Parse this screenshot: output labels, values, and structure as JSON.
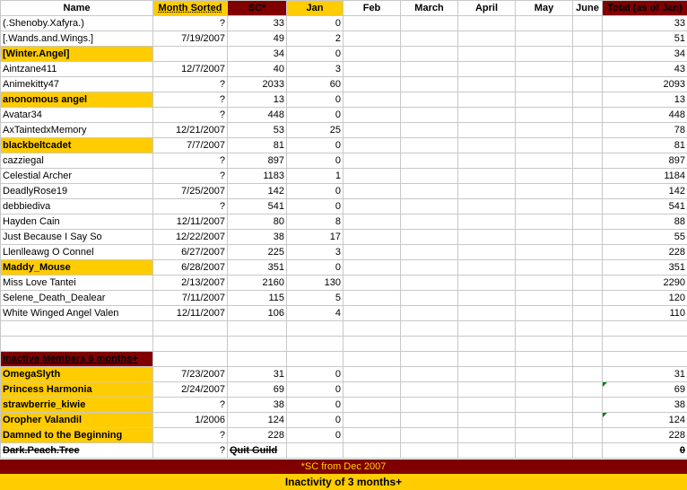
{
  "headers": {
    "name": "Name",
    "month_sorted": "Month Sorted",
    "sc": "SC*",
    "jan": "Jan",
    "feb": "Feb",
    "march": "March",
    "april": "April",
    "may": "May",
    "june": "June",
    "total": "Total (as of Jan)"
  },
  "active_members": [
    {
      "name": "(.Shenoby.Xafyra.)",
      "month": "?",
      "sc": "33",
      "jan": "0",
      "total": "33",
      "highlight": false
    },
    {
      "name": "[.Wands.and.Wings.]",
      "month": "7/19/2007",
      "sc": "49",
      "jan": "2",
      "total": "51",
      "highlight": false
    },
    {
      "name": "[Winter.Angel]",
      "month": "",
      "sc": "34",
      "jan": "0",
      "total": "34",
      "highlight": true
    },
    {
      "name": "Aintzane411",
      "month": "12/7/2007",
      "sc": "40",
      "jan": "3",
      "total": "43",
      "highlight": false
    },
    {
      "name": "Animekitty47",
      "month": "?",
      "sc": "2033",
      "jan": "60",
      "total": "2093",
      "highlight": false
    },
    {
      "name": "anonomous angel",
      "month": "?",
      "sc": "13",
      "jan": "0",
      "total": "13",
      "highlight": true
    },
    {
      "name": "Avatar34",
      "month": "?",
      "sc": "448",
      "jan": "0",
      "total": "448",
      "highlight": false
    },
    {
      "name": "AxTaintedxMemory",
      "month": "12/21/2007",
      "sc": "53",
      "jan": "25",
      "total": "78",
      "highlight": false
    },
    {
      "name": "blackbeltcadet",
      "month": "7/7/2007",
      "sc": "81",
      "jan": "0",
      "total": "81",
      "highlight": true
    },
    {
      "name": "cazziegal",
      "month": "?",
      "sc": "897",
      "jan": "0",
      "total": "897",
      "highlight": false
    },
    {
      "name": "Celestial Archer",
      "month": "?",
      "sc": "1183",
      "jan": "1",
      "total": "1184",
      "highlight": false
    },
    {
      "name": "DeadlyRose19",
      "month": "7/25/2007",
      "sc": "142",
      "jan": "0",
      "total": "142",
      "highlight": false
    },
    {
      "name": "debbiediva",
      "month": "?",
      "sc": "541",
      "jan": "0",
      "total": "541",
      "highlight": false
    },
    {
      "name": "Hayden Cain",
      "month": "12/11/2007",
      "sc": "80",
      "jan": "8",
      "total": "88",
      "highlight": false
    },
    {
      "name": "Just Because I Say So",
      "month": "12/22/2007",
      "sc": "38",
      "jan": "17",
      "total": "55",
      "highlight": false
    },
    {
      "name": "Llenlleawg O Connel",
      "month": "6/27/2007",
      "sc": "225",
      "jan": "3",
      "total": "228",
      "highlight": false
    },
    {
      "name": "Maddy_Mouse",
      "month": "6/28/2007",
      "sc": "351",
      "jan": "0",
      "total": "351",
      "highlight": true
    },
    {
      "name": "Miss Love Tantei",
      "month": "2/13/2007",
      "sc": "2160",
      "jan": "130",
      "total": "2290",
      "highlight": false
    },
    {
      "name": "Selene_Death_Dealear",
      "month": "7/11/2007",
      "sc": "115",
      "jan": "5",
      "total": "120",
      "highlight": false
    },
    {
      "name": "White Winged Angel Valen",
      "month": "12/11/2007",
      "sc": "106",
      "jan": "4",
      "total": "110",
      "highlight": false
    }
  ],
  "inactive_section_title": "Inactive Members 6 months+",
  "inactive_members": [
    {
      "name": "OmegaSlyth",
      "month": "7/23/2007",
      "sc": "31",
      "jan": "0",
      "total": "31",
      "flag": false
    },
    {
      "name": "Princess Harmonia",
      "month": "2/24/2007",
      "sc": "69",
      "jan": "0",
      "total": "69",
      "flag": true
    },
    {
      "name": "strawberrie_kiwie",
      "month": "?",
      "sc": "38",
      "jan": "0",
      "total": "38",
      "flag": false
    },
    {
      "name": "Oropher Valandil",
      "month": "1/2006",
      "sc": "124",
      "jan": "0",
      "total": "124",
      "flag": true
    },
    {
      "name": "Damned to the Beginning",
      "month": "?",
      "sc": "228",
      "jan": "0",
      "total": "228",
      "flag": false
    }
  ],
  "quit_member": {
    "name": "Dark.Peach.Tree",
    "month": "?",
    "sc": "Quit Guild",
    "total": "0"
  },
  "footer_note": "*SC from Dec 2007",
  "footer_legend": "Inactivity of 3 months+",
  "colors": {
    "maroon": "#800000",
    "gold": "#ffcc00",
    "flag": "#008000"
  }
}
